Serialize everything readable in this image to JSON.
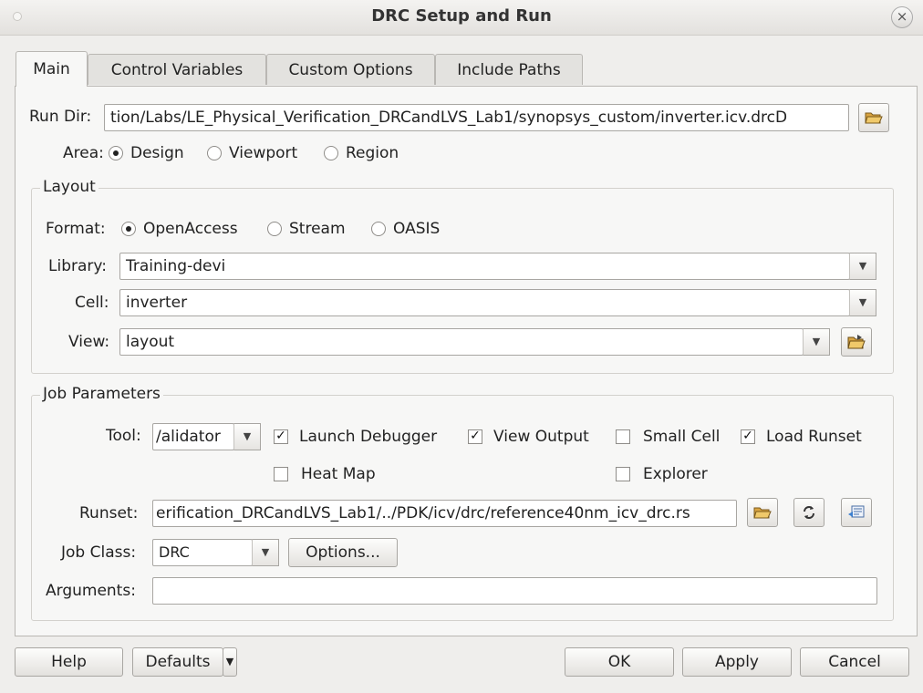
{
  "window": {
    "title": "DRC Setup and Run",
    "close_glyph": "×"
  },
  "tabs": [
    {
      "label": "Main",
      "active": true
    },
    {
      "label": "Control Variables",
      "active": false
    },
    {
      "label": "Custom Options",
      "active": false
    },
    {
      "label": "Include Paths",
      "active": false
    }
  ],
  "run_dir": {
    "label": "Run Dir:",
    "value": "tion/Labs/LE_Physical_Verification_DRCandLVS_Lab1/synopsys_custom/inverter.icv.drcD",
    "browse_icon": "folder-open-icon"
  },
  "area": {
    "label": "Area:",
    "options": [
      "Design",
      "Viewport",
      "Region"
    ],
    "selected": "Design"
  },
  "layout": {
    "group_title": "Layout",
    "format": {
      "label": "Format:",
      "options": [
        "OpenAccess",
        "Stream",
        "OASIS"
      ],
      "selected": "OpenAccess"
    },
    "library": {
      "label": "Library:",
      "value": "Training-devi"
    },
    "cell": {
      "label": "Cell:",
      "value": "inverter"
    },
    "view": {
      "label": "View:",
      "value": "layout",
      "browse_icon": "folder-browse-icon"
    }
  },
  "job": {
    "group_title": "Job Parameters",
    "tool": {
      "label": "Tool:",
      "value": "/alidator"
    },
    "checks": {
      "launch_debugger": {
        "label": "Launch Debugger",
        "checked": true
      },
      "view_output": {
        "label": "View Output",
        "checked": true
      },
      "small_cell": {
        "label": "Small Cell",
        "checked": false
      },
      "load_runset": {
        "label": "Load Runset",
        "checked": true
      },
      "heat_map": {
        "label": "Heat Map",
        "checked": false
      },
      "explorer": {
        "label": "Explorer",
        "checked": false
      }
    },
    "check_glyph": "✓",
    "runset": {
      "label": "Runset:",
      "value": "erification_DRCandLVS_Lab1/../PDK/icv/drc/reference40nm_icv_drc.rs"
    },
    "job_class": {
      "label": "Job Class:",
      "value": "DRC",
      "options_button": "Options..."
    },
    "arguments": {
      "label": "Arguments:",
      "value": ""
    }
  },
  "combo_arrow": "▼",
  "buttons": {
    "help": "Help",
    "defaults": "Defaults",
    "ok": "OK",
    "apply": "Apply",
    "cancel": "Cancel"
  }
}
